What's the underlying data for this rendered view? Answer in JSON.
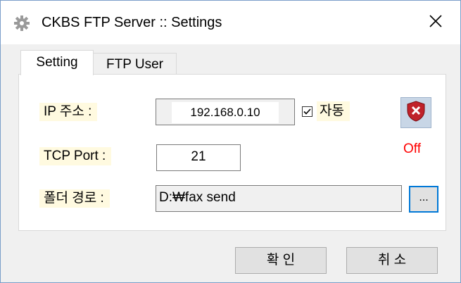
{
  "window": {
    "title": "CKBS FTP Server :: Settings"
  },
  "tabs": [
    {
      "label": "Setting"
    },
    {
      "label": "FTP User"
    }
  ],
  "form": {
    "ip_label": "IP 주소 :",
    "ip_value": "192.168.0.10",
    "auto_label": "자동",
    "auto_checked": true,
    "server_status": "Off",
    "port_label": "TCP Port :",
    "port_value": "21",
    "folder_label": "폴더 경로 :",
    "folder_value": "D:₩fax send",
    "browse_label": "..."
  },
  "buttons": {
    "ok_label": "확 인",
    "cancel_label": "취 소"
  },
  "colors": {
    "label_bg": "#fffae0",
    "status_off": "#ff0000",
    "focus_border": "#0078d7"
  },
  "icons": {
    "app": "gear-icon",
    "close": "close-icon",
    "server_stop": "shield-x-icon",
    "check": "checkmark-icon"
  }
}
